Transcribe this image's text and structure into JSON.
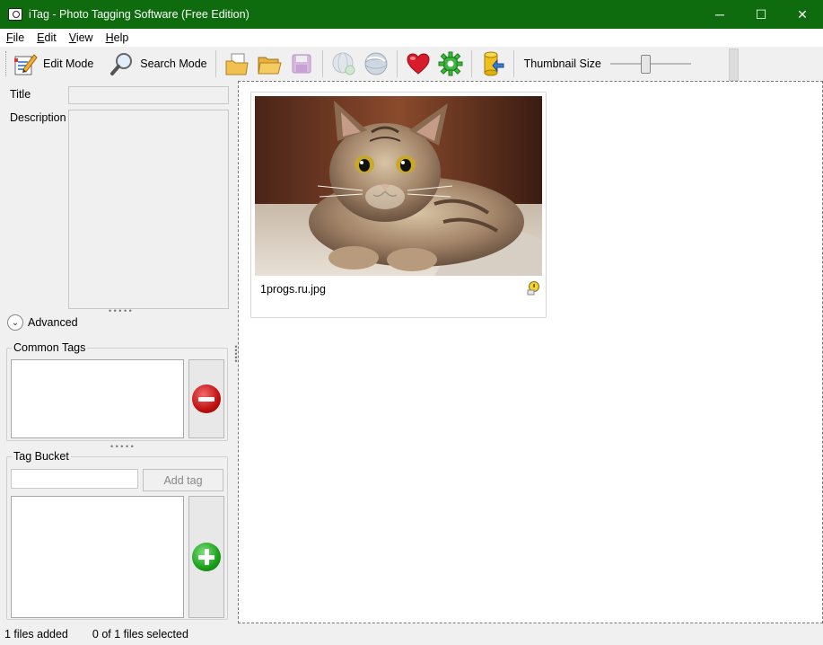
{
  "window": {
    "title": "iTag - Photo Tagging Software (Free Edition)",
    "minimize": "─",
    "maximize": "☐",
    "close": "✕"
  },
  "menu": {
    "items": [
      {
        "label": "File",
        "key": "F",
        "rest": "ile"
      },
      {
        "label": "Edit",
        "key": "E",
        "rest": "dit"
      },
      {
        "label": "View",
        "key": "V",
        "rest": "iew"
      },
      {
        "label": "Help",
        "key": "H",
        "rest": "elp"
      }
    ]
  },
  "toolbar": {
    "edit_mode": "Edit Mode",
    "search_mode": "Search Mode",
    "thumbnail_size_label": "Thumbnail Size",
    "thumbnail_size_value": 0.43,
    "icons": [
      "edit-mode-icon",
      "search-mode-icon",
      "open-file-icon",
      "open-folder-icon",
      "save-icon",
      "globe-disabled-icon",
      "globe-icon",
      "favorite-heart-icon",
      "settings-gear-icon",
      "database-export-icon"
    ]
  },
  "left_panel": {
    "title_label": "Title",
    "title_value": "",
    "description_label": "Description",
    "description_value": "",
    "advanced_label": "Advanced",
    "common_tags_label": "Common Tags",
    "tag_bucket_label": "Tag Bucket",
    "tag_input_value": "",
    "add_tag_label": "Add tag"
  },
  "main": {
    "thumbnails": [
      {
        "filename": "1progs.ru.jpg",
        "status_icon": "warning-tag-icon"
      }
    ]
  },
  "status": {
    "files_added": "1 files added",
    "selection": "0 of 1 files selected"
  },
  "colors": {
    "titlebar": "#0e6b0e",
    "remove_button": "#c01010",
    "add_button": "#19a019"
  }
}
